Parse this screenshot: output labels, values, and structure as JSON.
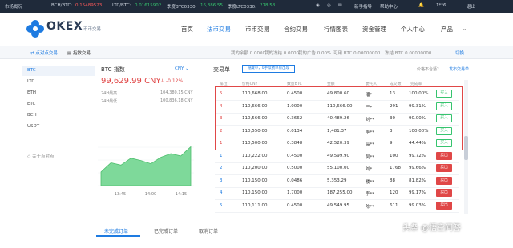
{
  "ticker": {
    "market_label": "市场概况",
    "items": [
      {
        "label": "BCH/BTC:",
        "value": "0.15489523",
        "trend": "down"
      },
      {
        "label": "LTC/BTC:",
        "value": "0.01615902",
        "trend": "up"
      },
      {
        "label": "季度BTC0330:",
        "value": "16,386.55",
        "trend": "up"
      },
      {
        "label": "季度LTC0330:",
        "value": "278.58",
        "trend": "up"
      }
    ],
    "right_links": [
      "新手指导",
      "帮助中心",
      "1**6",
      "退出"
    ]
  },
  "header": {
    "logo_text": "OKEX",
    "logo_sub": "币币交易",
    "nav": [
      "首页",
      "法币交易",
      "币币交易",
      "合约交易",
      "行情图表",
      "资金管理",
      "个人中心",
      "产品"
    ],
    "active_nav": "法币交易"
  },
  "subbar": {
    "tabs": [
      "点对点交易",
      "指数交易"
    ],
    "stats": [
      "我的余额 0.0000",
      "我的冻结 0.0000",
      "我的广告 0.00%",
      "可用 BTC 0.00000000",
      "冻结 BTC 0.00000000"
    ],
    "switch_label": "切换"
  },
  "sidebar": {
    "items": [
      "BTC",
      "LTC",
      "ETH",
      "ETC",
      "BCH",
      "USDT"
    ],
    "active": "BTC",
    "about": "关于点对点"
  },
  "index": {
    "title": "BTC 指数",
    "currency": "CNY",
    "price": "99,629.99 CNY",
    "change": "-0.12%",
    "high_label": "24H最高",
    "high_value": "104,380.15 CNY",
    "low_label": "24H最低",
    "low_value": "100,836.18 CNY",
    "chart_times": [
      "13:45",
      "14:00",
      "14:15"
    ]
  },
  "chart_data": {
    "type": "area",
    "x": [
      "13:35",
      "13:40",
      "13:45",
      "13:50",
      "13:55",
      "14:00",
      "14:05",
      "14:10",
      "14:15",
      "14:20"
    ],
    "series": [
      {
        "values": [
          99500,
          99700,
          99650,
          99800,
          99750,
          99680,
          99820,
          99900,
          99850,
          100050
        ]
      }
    ],
    "xlabel": "",
    "ylabel": "",
    "area_color": "#6fd08a"
  },
  "orderbook": {
    "title": "交易单",
    "filter": "隐藏小，0手续费单价出现",
    "help": "价格不合适？",
    "post_ad": "发布交易单",
    "headers": [
      "排位",
      "价格CNY",
      "数量BTC",
      "金额",
      "委托人",
      "成交数",
      "完成率",
      ""
    ],
    "rows": [
      {
        "rank": "5",
        "price": "110,668.00",
        "qty": "0.4500",
        "amount": "49,800.60",
        "trader": "潘*",
        "count": "13",
        "rate": "100.00%",
        "action": "买入",
        "side": "ask"
      },
      {
        "rank": "4",
        "price": "110,666.00",
        "qty": "1.0000",
        "amount": "110,666.00",
        "trader": "严*",
        "count": "291",
        "rate": "99.31%",
        "action": "买入",
        "side": "ask"
      },
      {
        "rank": "3",
        "price": "110,566.00",
        "qty": "0.3662",
        "amount": "40,489.26",
        "trader": "刘**",
        "count": "30",
        "rate": "90.00%",
        "action": "买入",
        "side": "ask"
      },
      {
        "rank": "2",
        "price": "110,550.00",
        "qty": "0.0134",
        "amount": "1,481.37",
        "trader": "李**",
        "count": "3",
        "rate": "100.00%",
        "action": "买入",
        "side": "ask"
      },
      {
        "rank": "1",
        "price": "110,500.00",
        "qty": "0.3848",
        "amount": "42,520.39",
        "trader": "高**",
        "count": "9",
        "rate": "44.44%",
        "action": "买入",
        "side": "ask"
      },
      {
        "rank": "1",
        "price": "110,222.00",
        "qty": "0.4500",
        "amount": "49,599.90",
        "trader": "吴**",
        "count": "100",
        "rate": "99.72%",
        "action": "卖出",
        "side": "bid"
      },
      {
        "rank": "2",
        "price": "110,200.00",
        "qty": "0.5000",
        "amount": "55,100.00",
        "trader": "刘*",
        "count": "1768",
        "rate": "99.66%",
        "action": "卖出",
        "side": "bid"
      },
      {
        "rank": "3",
        "price": "110,150.00",
        "qty": "0.0486",
        "amount": "5,353.29",
        "trader": "楼**",
        "count": "88",
        "rate": "81.82%",
        "action": "卖出",
        "side": "bid"
      },
      {
        "rank": "4",
        "price": "110,150.00",
        "qty": "1.7000",
        "amount": "187,255.00",
        "trader": "李**",
        "count": "120",
        "rate": "99.17%",
        "action": "卖出",
        "side": "bid"
      },
      {
        "rank": "5",
        "price": "110,111.00",
        "qty": "0.4500",
        "amount": "49,549.95",
        "trader": "陈**",
        "count": "611",
        "rate": "99.03%",
        "action": "卖出",
        "side": "bid"
      }
    ]
  },
  "bottom_tabs": [
    "未完成订单",
    "已完成订单",
    "取消订单"
  ],
  "watermark": "头条 @悟空问答"
}
